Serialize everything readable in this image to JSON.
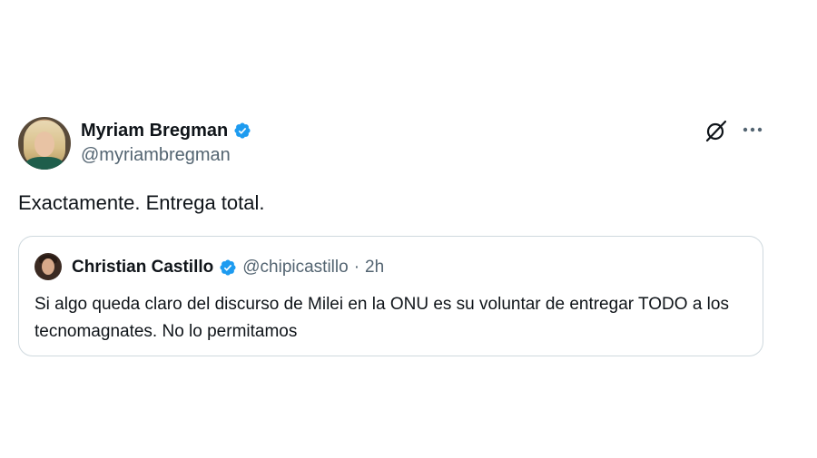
{
  "tweet": {
    "author": {
      "display_name": "Myriam Bregman",
      "handle": "@myriambregman",
      "verified": true
    },
    "text": "Exactamente. Entrega total.",
    "icons": {
      "grok": "grok-icon",
      "more": "more-icon"
    }
  },
  "quoted_tweet": {
    "author": {
      "display_name": "Christian Castillo",
      "handle": "@chipicastillo",
      "verified": true
    },
    "separator": "·",
    "time": "2h",
    "text": "Si algo queda claro del discurso de Milei en la ONU es su voluntar de entregar TODO a los tecnomagnates. No lo permitamos"
  },
  "colors": {
    "text_primary": "#0f1419",
    "text_secondary": "#536471",
    "verified_blue": "#1d9bf0",
    "border": "#cfd9de"
  }
}
